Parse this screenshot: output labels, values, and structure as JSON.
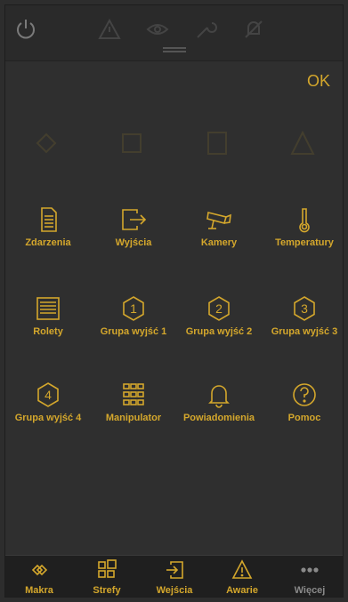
{
  "header": {
    "ok_label": "OK"
  },
  "grid": [
    {
      "label": "Zdarzenia",
      "icon": "document-icon"
    },
    {
      "label": "Wyjścia",
      "icon": "exit-arrow-icon"
    },
    {
      "label": "Kamery",
      "icon": "camera-icon"
    },
    {
      "label": "Temperatury",
      "icon": "thermometer-icon"
    },
    {
      "label": "Rolety",
      "icon": "blinds-icon"
    },
    {
      "label": "Grupa wyjść 1",
      "icon": "hexagon-1-icon"
    },
    {
      "label": "Grupa wyjść 2",
      "icon": "hexagon-2-icon"
    },
    {
      "label": "Grupa wyjść 3",
      "icon": "hexagon-3-icon"
    },
    {
      "label": "Grupa wyjść 4",
      "icon": "hexagon-4-icon"
    },
    {
      "label": "Manipulator",
      "icon": "keypad-icon"
    },
    {
      "label": "Powiadomienia",
      "icon": "bell-icon"
    },
    {
      "label": "Pomoc",
      "icon": "help-icon"
    }
  ],
  "hex_digits": [
    "1",
    "2",
    "3",
    "4"
  ],
  "tabs": [
    {
      "label": "Makra",
      "icon": "macro-icon"
    },
    {
      "label": "Strefy",
      "icon": "zones-icon"
    },
    {
      "label": "Wejścia",
      "icon": "entry-icon"
    },
    {
      "label": "Awarie",
      "icon": "warning-icon"
    },
    {
      "label": "Więcej",
      "icon": "more-icon"
    }
  ],
  "colors": {
    "accent": "#d4a72c",
    "background": "#2f2f2f",
    "tabbar": "#1f1f1f"
  }
}
